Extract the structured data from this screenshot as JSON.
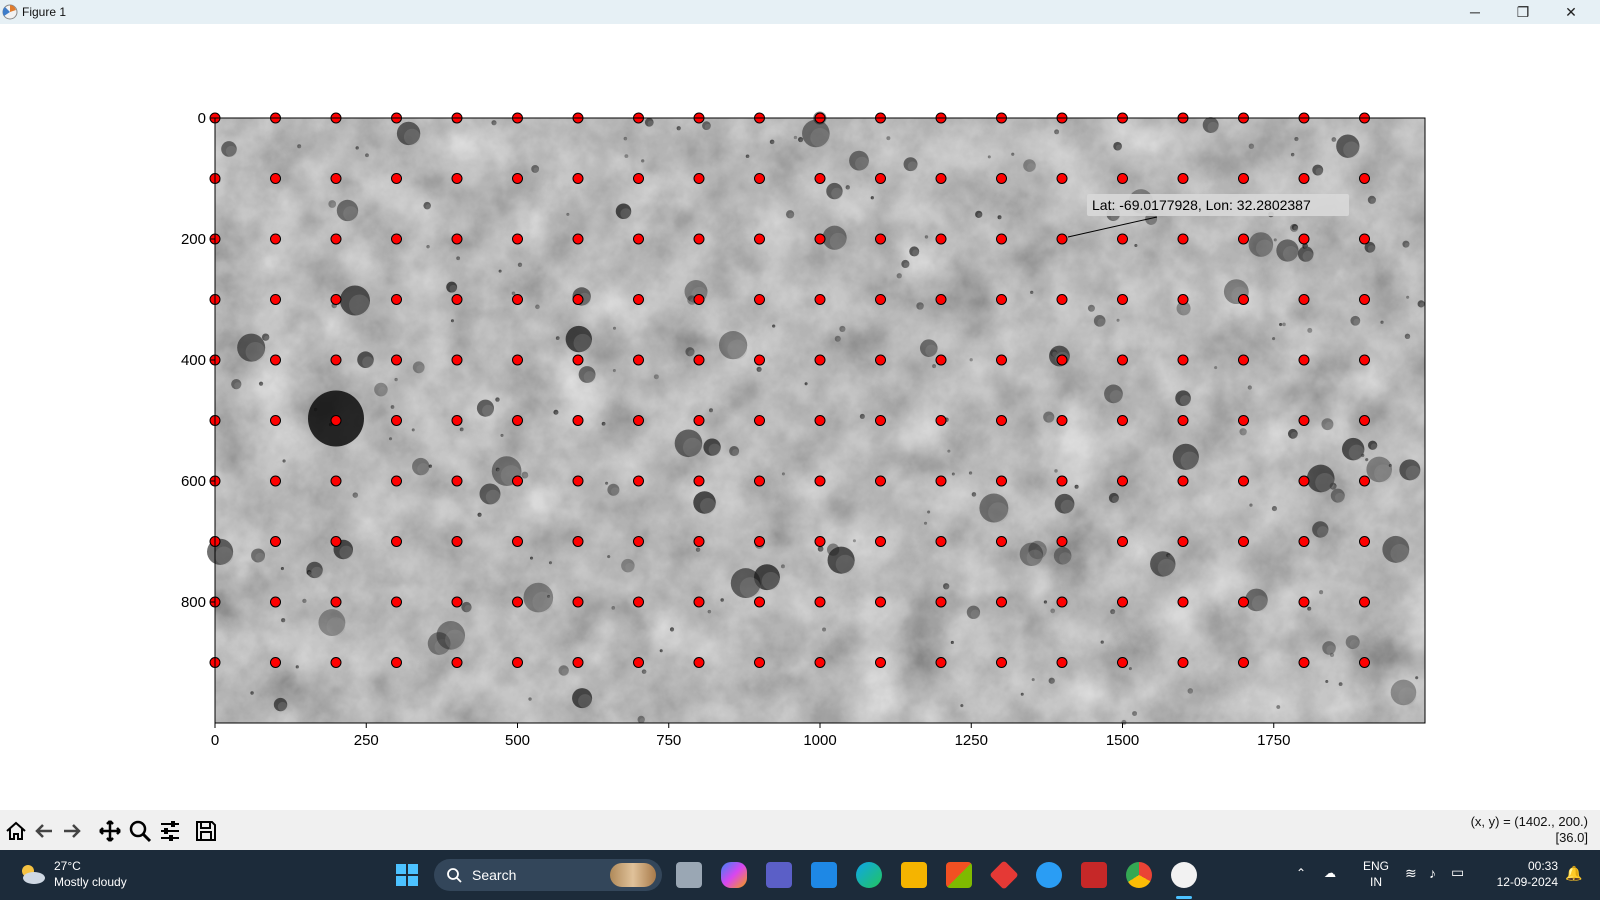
{
  "window": {
    "title": "Figure 1",
    "controls": {
      "minimize": "─",
      "maximize": "❐",
      "close": "✕"
    }
  },
  "chart_data": {
    "type": "scatter",
    "background": "grayscale lunar surface image",
    "title": "",
    "xlabel": "",
    "ylabel": "",
    "xlim": [
      0,
      2000
    ],
    "ylim": [
      1000,
      0
    ],
    "x_ticks": [
      0,
      250,
      500,
      750,
      1000,
      1250,
      1500,
      1750
    ],
    "y_ticks": [
      0,
      200,
      400,
      600,
      800
    ],
    "grid": false,
    "series": [
      {
        "marker": "circle",
        "color": "#ff0000",
        "x_values": [
          0,
          100,
          200,
          300,
          400,
          500,
          600,
          700,
          800,
          900,
          1000,
          1100,
          1200,
          1300,
          1400,
          1500,
          1600,
          1700,
          1800,
          1900
        ],
        "y_values": [
          0,
          100,
          200,
          300,
          400,
          500,
          600,
          700,
          800,
          900
        ],
        "layout": "grid (every x paired with every y)"
      }
    ],
    "annotations": [
      {
        "text": "Lat: -69.0177928, Lon: 32.2802387",
        "x": 1400,
        "y": 200
      }
    ]
  },
  "toolbar": {
    "buttons": [
      "home-icon",
      "back-icon",
      "forward-icon",
      "pan-icon",
      "zoom-icon",
      "configure-icon",
      "save-icon"
    ],
    "coord_line1": "(x, y) = (1402., 200.)",
    "coord_line2": "[36.0]"
  },
  "taskbar": {
    "weather_temp": "27°C",
    "weather_desc": "Mostly cloudy",
    "search_label": "Search",
    "lang_line1": "ENG",
    "lang_line2": "IN",
    "time": "00:33",
    "date": "12-09-2024"
  }
}
